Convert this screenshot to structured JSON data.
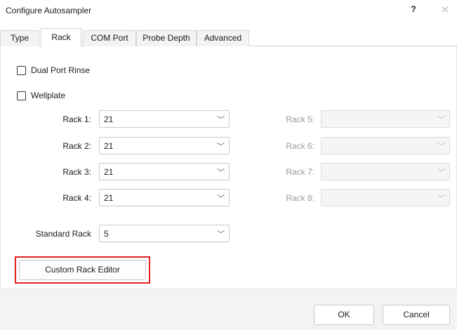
{
  "window": {
    "title": "Configure Autosampler",
    "help_label": "?",
    "close_label": "✕"
  },
  "tabs": [
    {
      "label": "Type",
      "active": false
    },
    {
      "label": "Rack",
      "active": true
    },
    {
      "label": "COM Port",
      "active": false
    },
    {
      "label": "Probe Depth",
      "active": false
    },
    {
      "label": "Advanced",
      "active": false
    }
  ],
  "options": {
    "dual_port_rinse": {
      "label": "Dual Port Rinse",
      "checked": false
    },
    "wellplate": {
      "label": "Wellplate",
      "checked": false
    }
  },
  "racks": [
    {
      "label": "Rack 1:",
      "value": "21",
      "enabled": true
    },
    {
      "label": "Rack 2:",
      "value": "21",
      "enabled": true
    },
    {
      "label": "Rack 3:",
      "value": "21",
      "enabled": true
    },
    {
      "label": "Rack 4:",
      "value": "21",
      "enabled": true
    },
    {
      "label": "Rack 5:",
      "value": "",
      "enabled": false
    },
    {
      "label": "Rack 6:",
      "value": "",
      "enabled": false
    },
    {
      "label": "Rack 7:",
      "value": "",
      "enabled": false
    },
    {
      "label": "Rack 8:",
      "value": "",
      "enabled": false
    }
  ],
  "standard_rack": {
    "label": "Standard Rack",
    "value": "5"
  },
  "custom_rack_editor": {
    "label": "Custom Rack Editor",
    "highlight_color": "#e02020"
  },
  "footer": {
    "ok_label": "OK",
    "cancel_label": "Cancel"
  },
  "icons": {
    "dropdown": "chevron-down-icon"
  }
}
